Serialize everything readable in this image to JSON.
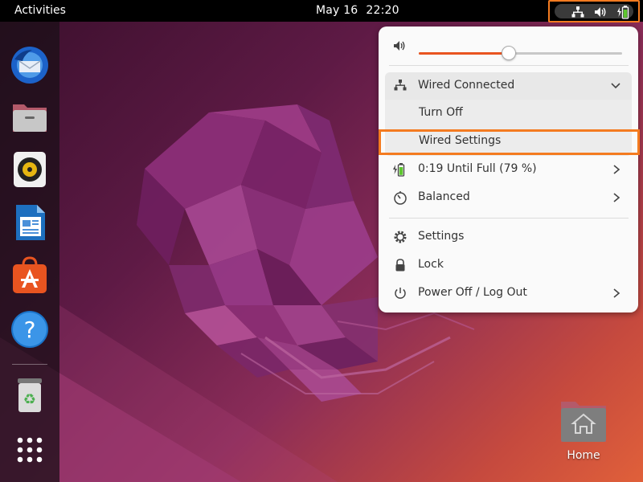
{
  "topbar": {
    "activities": "Activities",
    "date": "May 16",
    "time": "22:20"
  },
  "tray": {
    "icons": [
      "network-wired-icon",
      "volume-icon",
      "battery-charging-icon"
    ]
  },
  "dock": {
    "items": [
      "thunderbird-icon",
      "files-icon",
      "rhythmbox-icon",
      "libreoffice-writer-icon",
      "software-center-icon",
      "help-icon",
      "trash-icon",
      "show-apps-icon"
    ]
  },
  "menu": {
    "volume": {
      "icon": "volume-icon",
      "level": 0.44
    },
    "wired": {
      "title": "Wired Connected",
      "turn_off": "Turn Off",
      "settings": "Wired Settings"
    },
    "battery": "0:19 Until Full (79 %)",
    "power_mode": "Balanced",
    "settings": "Settings",
    "lock": "Lock",
    "power_off": "Power Off / Log Out"
  },
  "desktop": {
    "home_label": "Home"
  },
  "colors": {
    "accent": "#e95420",
    "highlight": "#f47b20",
    "battery_green": "#5ec72f"
  }
}
